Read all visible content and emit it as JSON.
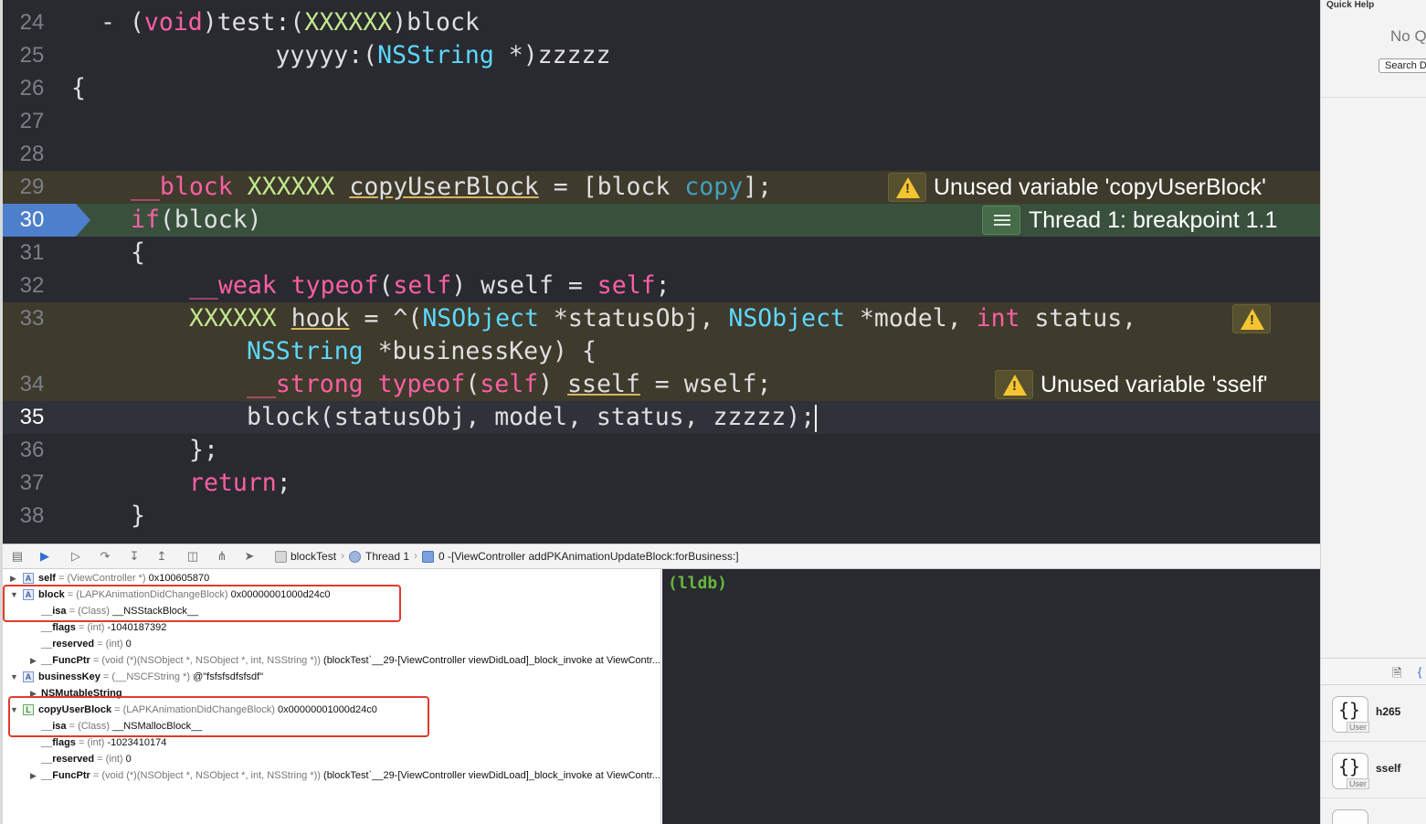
{
  "editor": {
    "lines": [
      {
        "num": "24",
        "tokens": [
          [
            "n",
            "- ("
          ],
          [
            "kw",
            "void"
          ],
          [
            "n",
            ")test:("
          ],
          [
            "ty2",
            "XXXXXX"
          ],
          [
            "n",
            ")block"
          ]
        ]
      },
      {
        "num": "25",
        "tokens": [
          [
            "n",
            "            yyyyy:("
          ],
          [
            "cl",
            "NSString"
          ],
          [
            "n",
            " *)zzzzz"
          ]
        ]
      },
      {
        "num": "26",
        "tokens": [
          [
            "n",
            "{"
          ]
        ]
      },
      {
        "num": "27",
        "tokens": []
      },
      {
        "num": "28",
        "tokens": []
      },
      {
        "num": "29",
        "tokens": [
          [
            "kw",
            "__block"
          ],
          [
            "n",
            " "
          ],
          [
            "ty2",
            "XXXXXX"
          ],
          [
            "n",
            " "
          ],
          [
            "u",
            "copyUserBlock"
          ],
          [
            "n",
            " = [block "
          ],
          [
            "sel",
            "copy"
          ],
          [
            "n",
            "];"
          ]
        ]
      },
      {
        "num": "30",
        "tokens": [
          [
            "kw",
            "if"
          ],
          [
            "n",
            "(block)"
          ]
        ]
      },
      {
        "num": "31",
        "tokens": [
          [
            "n",
            "{"
          ]
        ]
      },
      {
        "num": "32",
        "tokens": [
          [
            "kw",
            "__weak"
          ],
          [
            "n",
            " "
          ],
          [
            "kw",
            "typeof"
          ],
          [
            "n",
            "("
          ],
          [
            "kw",
            "self"
          ],
          [
            "n",
            ") wself = "
          ],
          [
            "kw",
            "self"
          ],
          [
            "n",
            ";"
          ]
        ]
      },
      {
        "num": "33",
        "tokens": [
          [
            "ty2",
            "XXXXXX"
          ],
          [
            "n",
            " "
          ],
          [
            "u",
            "hook"
          ],
          [
            "n",
            " = ^("
          ],
          [
            "cl",
            "NSObject"
          ],
          [
            "n",
            " *statusObj, "
          ],
          [
            "cl",
            "NSObject"
          ],
          [
            "n",
            " *model, "
          ],
          [
            "kw",
            "int"
          ],
          [
            "n",
            " status,"
          ]
        ]
      },
      {
        "num": "",
        "tokens": [
          [
            "cl",
            "NSString"
          ],
          [
            "n",
            " *businessKey) {"
          ]
        ]
      },
      {
        "num": "34",
        "tokens": [
          [
            "kw",
            "__strong"
          ],
          [
            "n",
            " "
          ],
          [
            "kw",
            "typeof"
          ],
          [
            "n",
            "("
          ],
          [
            "kw",
            "self"
          ],
          [
            "n",
            ") "
          ],
          [
            "u",
            "sself"
          ],
          [
            "n",
            " = wself;"
          ]
        ]
      },
      {
        "num": "35",
        "tokens": [
          [
            "n",
            "block(statusObj, model, status, zzzzz);"
          ]
        ]
      },
      {
        "num": "36",
        "tokens": [
          [
            "n",
            "};"
          ]
        ]
      },
      {
        "num": "37",
        "tokens": [
          [
            "kw",
            "return"
          ],
          [
            "n",
            ";"
          ]
        ]
      },
      {
        "num": "38",
        "tokens": [
          [
            "n",
            "}"
          ]
        ]
      }
    ],
    "annotations": {
      "unused_copy": "Unused variable 'copyUserBlock'",
      "thread": "Thread 1: breakpoint 1.1",
      "unused_sself": "Unused variable 'sself'"
    }
  },
  "debug_bar": {
    "target": "blockTest",
    "thread": "Thread 1",
    "frame": "0 -[ViewController addPKAnimationUpdateBlock:forBusiness:]"
  },
  "variables": [
    {
      "name": "self",
      "type": "(ViewController *)",
      "value": "0x100605870",
      "icon": "A",
      "expand": "right"
    },
    {
      "name": "block",
      "type": "(LAPKAnimationDidChangeBlock)",
      "value": "0x00000001000d24c0",
      "icon": "A",
      "expand": "down"
    },
    {
      "name": "__isa",
      "type": "(Class)",
      "value": "__NSStackBlock__",
      "icon": "",
      "expand": ""
    },
    {
      "name": "__flags",
      "type": "(int)",
      "value": "-1040187392",
      "icon": "",
      "expand": ""
    },
    {
      "name": "__reserved",
      "type": "(int)",
      "value": "0",
      "icon": "",
      "expand": ""
    },
    {
      "name": "__FuncPtr",
      "type": "(void (*)(NSObject *, NSObject *, int, NSString *))",
      "value": "(blockTest`__29-[ViewController viewDidLoad]_block_invoke at ViewContr...",
      "icon": "",
      "expand": "right"
    },
    {
      "name": "businessKey",
      "type": "(__NSCFString *)",
      "value": "@\"fsfsfsdfsfsdf\"",
      "icon": "A",
      "expand": "down"
    },
    {
      "name": "NSMutableString",
      "type": "",
      "value": "",
      "icon": "",
      "expand": "right"
    },
    {
      "name": "copyUserBlock",
      "type": "(LAPKAnimationDidChangeBlock)",
      "value": "0x00000001000d24c0",
      "icon": "L",
      "expand": "down"
    },
    {
      "name": "__isa",
      "type": "(Class)",
      "value": "__NSMallocBlock__",
      "icon": "",
      "expand": ""
    },
    {
      "name": "__flags",
      "type": "(int)",
      "value": "-1023410174",
      "icon": "",
      "expand": ""
    },
    {
      "name": "__reserved",
      "type": "(int)",
      "value": "0",
      "icon": "",
      "expand": ""
    },
    {
      "name": "__FuncPtr",
      "type": "(void (*)(NSObject *, NSObject *, int, NSString *))",
      "value": "(blockTest`__29-[ViewController viewDidLoad]_block_invoke at ViewContr...",
      "icon": "",
      "expand": "right"
    }
  ],
  "console": {
    "prompt": "(lldb)"
  },
  "inspector": {
    "title": "Quick Help",
    "no_quick_help": "No Qu",
    "search_button": "Search D",
    "snippets": [
      {
        "label": "h265",
        "badge": "User",
        "icon": "braces-icon"
      },
      {
        "label": "sself",
        "badge": "User",
        "icon": "braces-icon"
      }
    ]
  },
  "colors": {
    "editor_bg": "#292a30",
    "keyword": "#fc5fa3",
    "class": "#5dd8ff",
    "warning_row": "#3e3a2c",
    "breakpoint_row": "#39503d",
    "breakpoint_marker": "#4d7fcb",
    "lldb": "#67b73c",
    "highlight_box": "#e03b2c"
  }
}
